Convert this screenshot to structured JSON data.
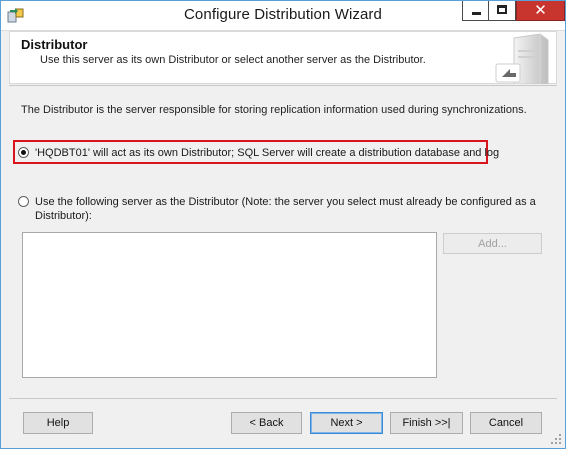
{
  "window": {
    "title": "Configure Distribution Wizard",
    "controls": {
      "minimize": "minimize",
      "maximize": "maximize",
      "close": "✕"
    }
  },
  "header": {
    "title": "Distributor",
    "subtitle": "Use this server as its own Distributor or select another server as the Distributor."
  },
  "description": "The Distributor is the server responsible for storing replication information used during synchronizations.",
  "options": [
    {
      "label": "'HQDBT01' will act as its own Distributor; SQL Server will create a distribution database and log",
      "selected": true
    },
    {
      "label": "Use the following server as the Distributor (Note: the server you select must already be configured as a Distributor):",
      "selected": false
    }
  ],
  "server_list": {
    "items": []
  },
  "add_button": {
    "label": "Add...",
    "enabled": false
  },
  "footer": {
    "help": "Help",
    "back": "< Back",
    "next": "Next >",
    "finish": "Finish >>|",
    "cancel": "Cancel"
  },
  "colors": {
    "highlight_frame": "#d9141c",
    "close_button": "#c7352e",
    "window_border": "#5a9fd6"
  },
  "icons": [
    "wizard-app-icon",
    "server-icon",
    "resize-grip-icon"
  ]
}
